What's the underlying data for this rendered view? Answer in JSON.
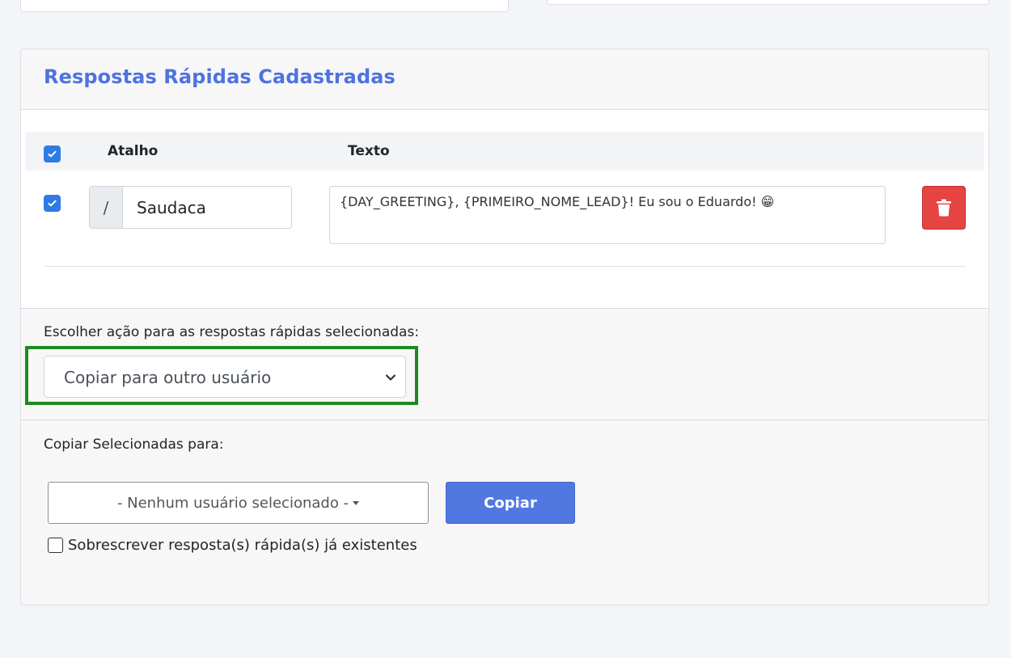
{
  "card": {
    "title": "Respostas Rápidas Cadastradas"
  },
  "table": {
    "headers": {
      "shortcut": "Atalho",
      "text": "Texto"
    },
    "rows": [
      {
        "checked": true,
        "shortcut_prefix": "/",
        "shortcut": "Saudaca",
        "text": "{DAY_GREETING}, {PRIMEIRO_NOME_LEAD}! Eu sou o Eduardo! 😁"
      }
    ]
  },
  "actions": {
    "label": "Escolher ação para as respostas rápidas selecionadas:",
    "selected": "Copiar para outro usuário"
  },
  "copy": {
    "label": "Copiar Selecionadas para:",
    "user_placeholder": "- Nenhum usuário selecionado -",
    "button": "Copiar",
    "overwrite_label": "Sobrescrever resposta(s) rápida(s) já existentes"
  },
  "colors": {
    "accent": "#4e73df",
    "danger": "#e64343",
    "highlight": "#1e8a1e",
    "checkbox": "#2f7be5"
  },
  "icons": [
    "check-icon",
    "trash-icon",
    "chevron-down-icon",
    "caret-down-icon"
  ]
}
